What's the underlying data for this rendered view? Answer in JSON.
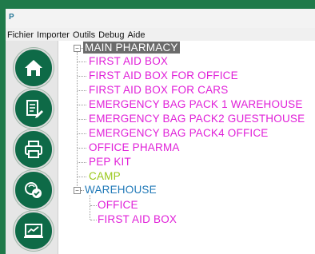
{
  "app": {
    "icon_glyph": "P"
  },
  "menu": [
    {
      "label": "Fichier"
    },
    {
      "label": "Importer"
    },
    {
      "label": "Outils"
    },
    {
      "label": "Debug"
    },
    {
      "label": "Aide"
    }
  ],
  "sidebar": {
    "buttons": [
      {
        "name": "home-button",
        "icon": "home-icon"
      },
      {
        "name": "documents-button",
        "icon": "document-edit-icon"
      },
      {
        "name": "print-button",
        "icon": "printer-icon"
      },
      {
        "name": "sync-button",
        "icon": "sync-icon"
      },
      {
        "name": "chart-button",
        "icon": "chart-icon"
      }
    ],
    "button_color": "#0e6a47"
  },
  "tree": {
    "root": "MAIN PHARMACY",
    "children": [
      {
        "label": "FIRST AID BOX",
        "color": "#e020d8"
      },
      {
        "label": "FIRST AID BOX FOR OFFICE",
        "color": "#e020d8"
      },
      {
        "label": "FIRST AID BOX FOR CARS",
        "color": "#e020d8"
      },
      {
        "label": "EMERGENCY BAG PACK 1 WAREHOUSE",
        "color": "#e020d8"
      },
      {
        "label": "EMERGENCY BAG PACK2 GUESTHOUSE",
        "color": "#e020d8"
      },
      {
        "label": "EMERGENCY BAG PACK4 OFFICE",
        "color": "#e020d8"
      },
      {
        "label": "OFFICE  PHARMA",
        "color": "#e020d8"
      },
      {
        "label": "PEP KIT",
        "color": "#e020d8"
      },
      {
        "label": "CAMP",
        "color": "#9ac81a"
      },
      {
        "label": "WAREHOUSE",
        "color": "#2079b8"
      }
    ],
    "warehouse_children": [
      {
        "label": "OFFICE",
        "color": "#e020d8"
      },
      {
        "label": "FIRST AID BOX",
        "color": "#e020d8"
      }
    ]
  }
}
